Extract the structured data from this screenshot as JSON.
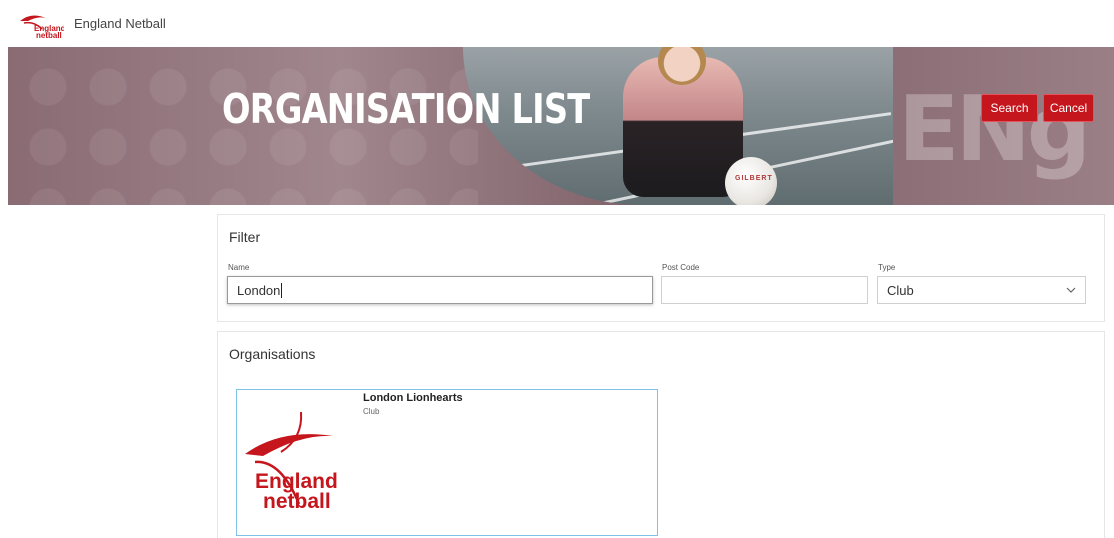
{
  "app": {
    "title": "England Netball"
  },
  "hero": {
    "title": "ORGANISATION LIST",
    "watermark": "ENg",
    "ball_text": "GILBERT",
    "search_label": "Search",
    "cancel_label": "Cancel"
  },
  "filter": {
    "heading": "Filter",
    "name_label": "Name",
    "name_value": "London",
    "postcode_label": "Post Code",
    "postcode_value": "",
    "type_label": "Type",
    "type_value": "Club"
  },
  "organisations": {
    "heading": "Organisations",
    "items": [
      {
        "name": "London Lionhearts",
        "type": "Club",
        "logo_line1": "England",
        "logo_line2": "netball"
      }
    ]
  },
  "colors": {
    "brand_red": "#c4161c",
    "card_border": "#7ec2ea"
  }
}
